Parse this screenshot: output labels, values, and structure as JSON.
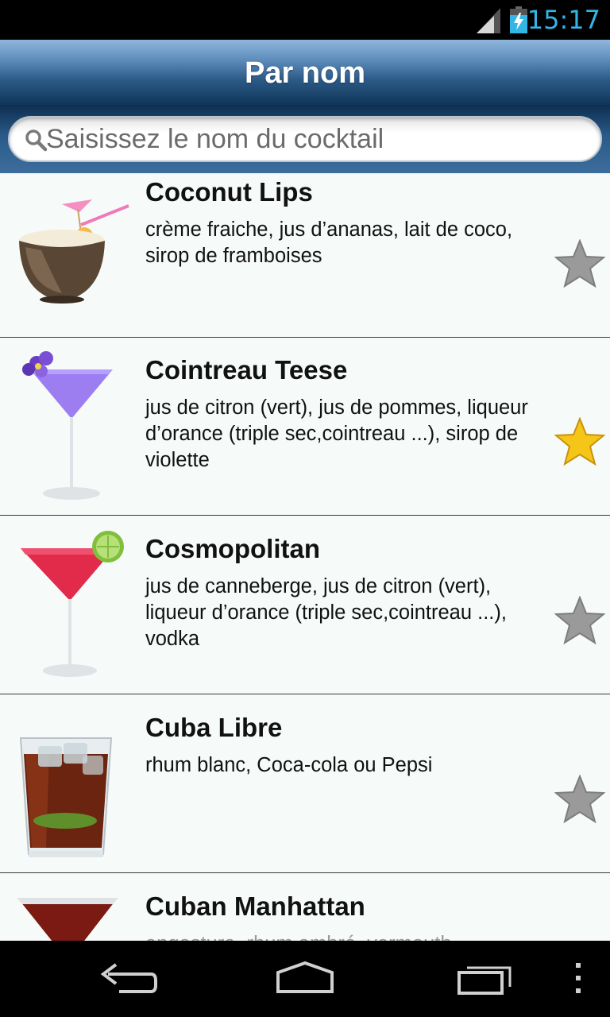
{
  "status_bar": {
    "time": "15:17",
    "icons": [
      "signal-icon",
      "battery-charging-icon"
    ],
    "time_color": "#33b5e5"
  },
  "header": {
    "title": "Par nom"
  },
  "search": {
    "placeholder": "Saisissez le nom du cocktail",
    "value": "",
    "icon": "search-icon"
  },
  "cocktails": [
    {
      "name": "Coconut Lips",
      "ingredients": "crème fraiche, jus d’ananas, lait de coco, sirop de framboises",
      "favorite": false
    },
    {
      "name": "Cointreau Teese",
      "ingredients": "jus de citron (vert), jus de pommes, liqueur d’orance (triple sec,cointreau ...), sirop de violette",
      "favorite": true
    },
    {
      "name": "Cosmopolitan",
      "ingredients": "jus de canneberge, jus de citron (vert), liqueur d’orance (triple sec,cointreau ...), vodka",
      "favorite": false
    },
    {
      "name": "Cuba Libre",
      "ingredients": "rhum blanc, Coca-cola ou Pepsi",
      "favorite": false
    },
    {
      "name": "Cuban Manhattan",
      "ingredients": "angostura, rhum ambré, vermouth",
      "favorite": false
    }
  ],
  "nav_bar": {
    "buttons": [
      "back-icon",
      "home-icon",
      "recent-apps-icon",
      "menu-icon"
    ]
  },
  "colors": {
    "favorite_star": "#f5c518",
    "unfavorite_star": "#9a9a9a",
    "header_dark": "#0f3558",
    "header_light": "#8fb6dd"
  }
}
